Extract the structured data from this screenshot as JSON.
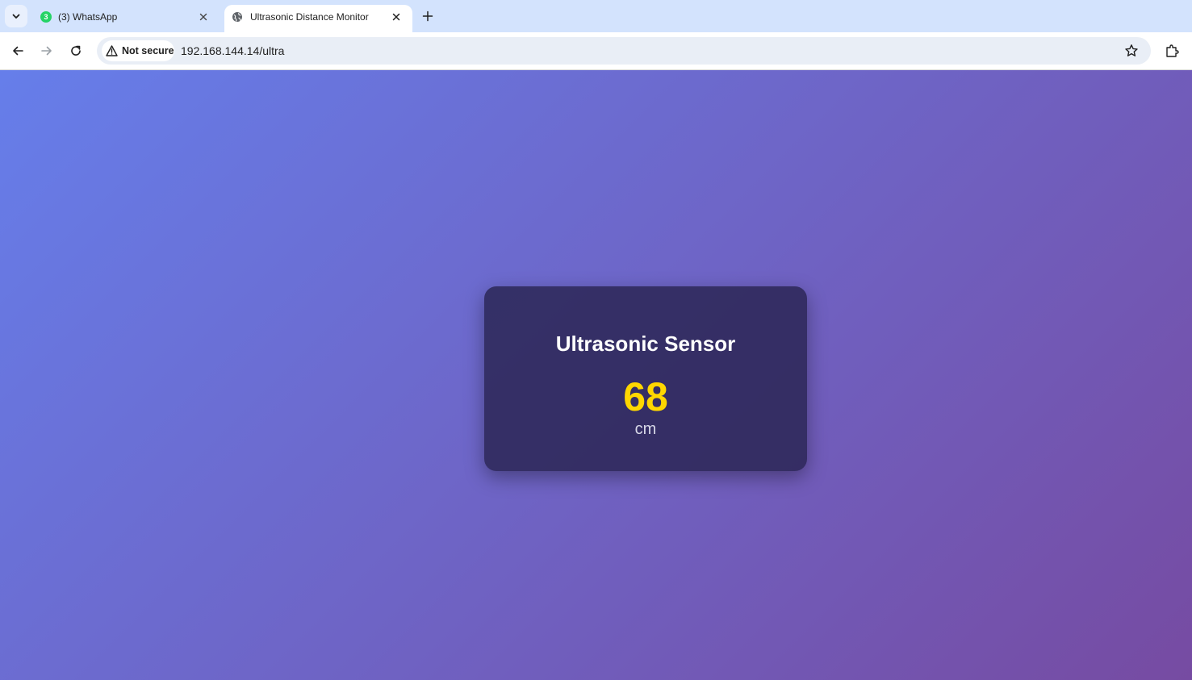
{
  "browser": {
    "tabs": [
      {
        "title": "(3) WhatsApp",
        "badge": "3",
        "icon": "whatsapp-icon",
        "active": false
      },
      {
        "title": "Ultrasonic Distance Monitor",
        "icon": "globe-icon",
        "active": true
      }
    ],
    "security_label": "Not secure",
    "url": "192.168.144.14/ultra"
  },
  "sensor_card": {
    "title": "Ultrasonic Sensor",
    "value": "68",
    "unit": "cm"
  },
  "colors": {
    "gradient_start": "#667eea",
    "gradient_end": "#764ba2",
    "value_color": "#ffd700"
  }
}
